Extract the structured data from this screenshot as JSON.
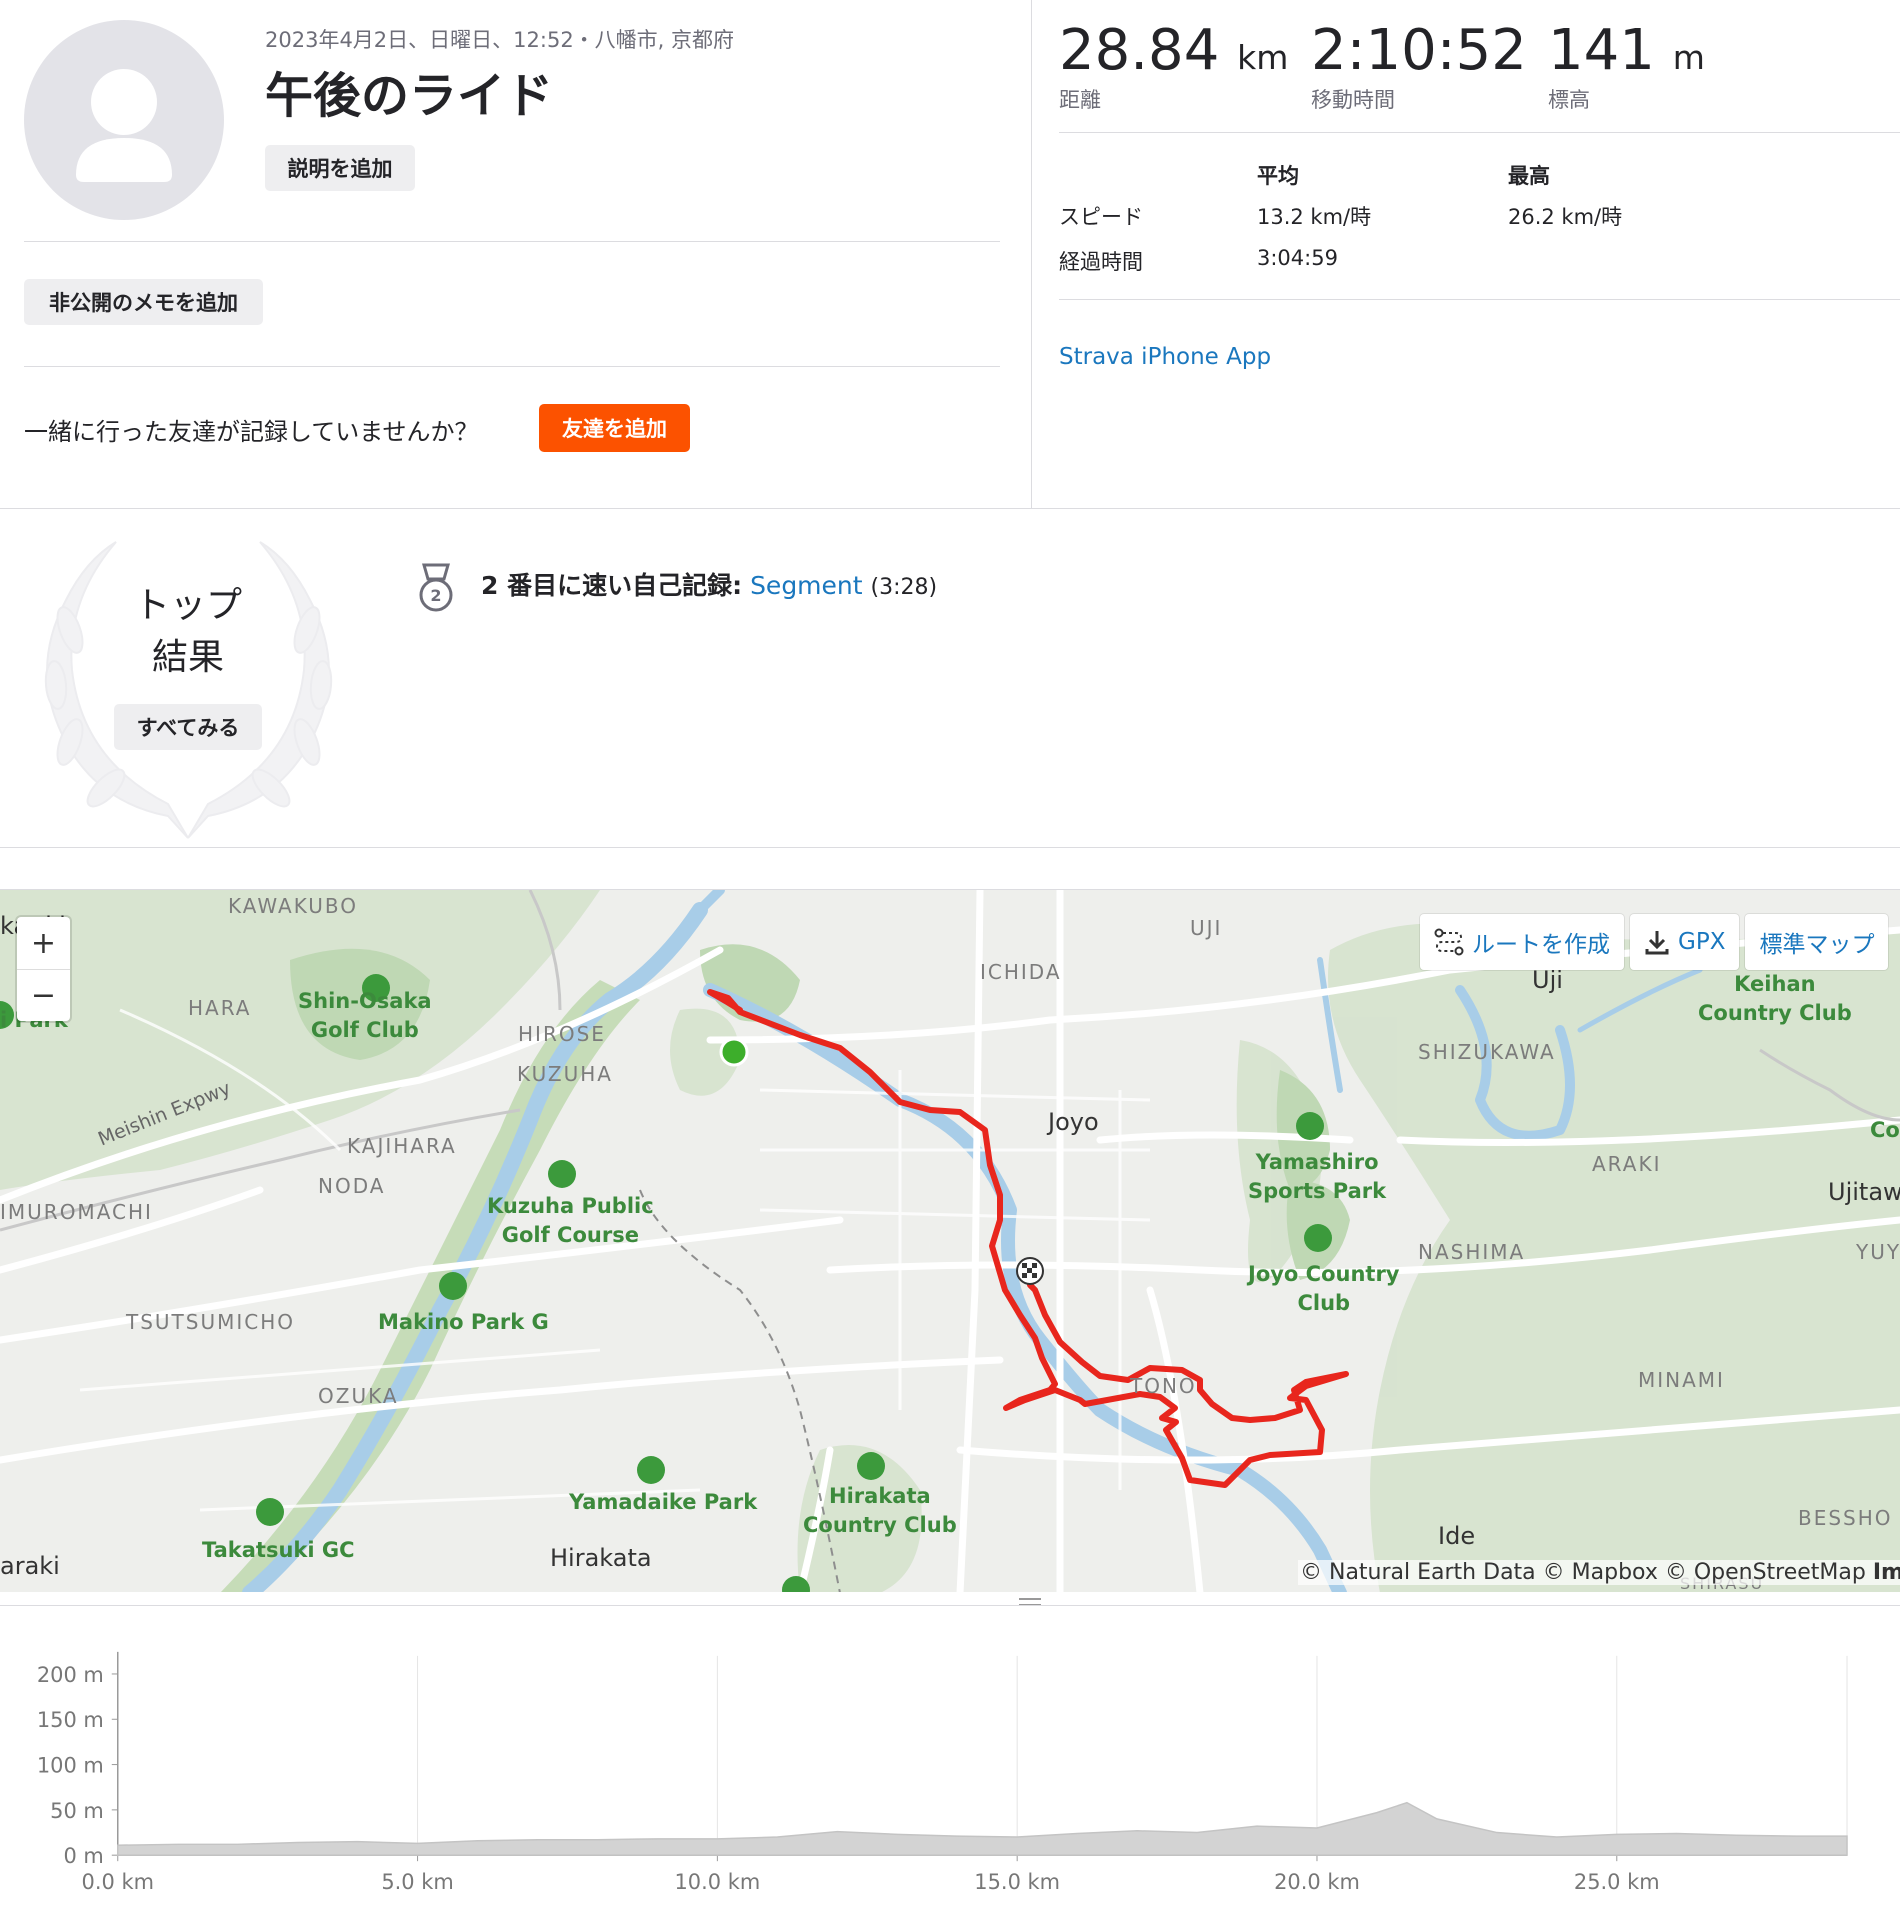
{
  "activity": {
    "meta_line": "2023年4月2日、日曜日、12:52・八幡市, 京都府",
    "title": "午後のライド",
    "add_description": "説明を追加",
    "add_private_note": "非公開のメモを追加",
    "friends_question": "一緒に行った友達が記録していませんか？",
    "add_friends": "友達を追加"
  },
  "stats": {
    "distance": {
      "value": "28.84",
      "unit": "km",
      "label": "距離"
    },
    "moving_time": {
      "value": "2:10:52",
      "label": "移動時間"
    },
    "elevation": {
      "value": "141",
      "unit": "m",
      "label": "標高"
    },
    "table": {
      "col_avg": "平均",
      "col_max": "最高",
      "speed_label": "スピード",
      "speed_avg": "13.2 km/時",
      "speed_max": "26.2 km/時",
      "elapsed_label": "経過時間",
      "elapsed_value": "3:04:59"
    },
    "device": "Strava iPhone App"
  },
  "achievements": {
    "top_results_label_line1": "トップ",
    "top_results_label_line2": "結果",
    "see_all": "すべてみる",
    "pr_text": "2 番目に速い自己記録:",
    "pr_segment": "Segment",
    "pr_time": "(3:28)",
    "medal_number": "2"
  },
  "map": {
    "zoom_in": "+",
    "zoom_out": "−",
    "controls": {
      "create_route": "ルートを作成",
      "gpx": "GPX",
      "map_style": "標準マップ"
    },
    "attribution": "© Natural Earth Data © Mapbox © OpenStreetMap",
    "attribution_more": "Imp",
    "labels": {
      "kawakubo": "KAWAKUBO",
      "hara": "HARA",
      "shin_osaka": [
        "Shin-Osaka",
        "Golf Club"
      ],
      "hirose": "HIROSE",
      "kuzuha": "KUZUHA",
      "kajihara": "KAJIHARA",
      "noda": "NODA",
      "kuzuha_golf": [
        "Kuzuha Public",
        "Golf Course"
      ],
      "makino": "Makino Park G",
      "imuromachi": "IMUROMACHI",
      "tsutsumicho": "TSUTSUMICHO",
      "ozuka": "OZUKA",
      "takatsuki_gc": "Takatsuki GC",
      "araki_left": "araki",
      "hirakata": "Hirakata",
      "yamadaike": "Yamadaike Park",
      "hirakata_cc": [
        "Hirakata",
        "Country Club"
      ],
      "ichida": "ICHIDA",
      "joyo": "Joyo",
      "uji_top": "UJI",
      "uji": "Uji",
      "shizukawa": "SHIZUKAWA",
      "keihan": [
        "Keihan",
        "Country Club"
      ],
      "yamashiro": [
        "Yamashiro",
        "Sports Park"
      ],
      "joyo_cc": [
        "Joyo Country",
        "Club"
      ],
      "araki_right": "ARAKI",
      "ujitawa": "Ujitawa",
      "nashima": "NASHIMA",
      "yuy": "YUY",
      "tono": "TONO",
      "minami": "MINAMI",
      "ide": "Ide",
      "bessho": "BESSHO",
      "shirasu": "SHIRASU",
      "meishin": "Meishin Expwy",
      "takatsuki": "kat ki",
      "left_park": "i Park",
      "co": "Co"
    }
  },
  "elevation_chart": {
    "y_ticks": [
      "200 m",
      "150 m",
      "100 m",
      "50 m",
      "0 m"
    ],
    "x_ticks": [
      "0.0 km",
      "5.0 km",
      "10.0 km",
      "15.0 km",
      "20.0 km",
      "25.0 km"
    ],
    "ylim": [
      0,
      220
    ],
    "xlim": [
      0,
      28.84
    ],
    "fill_color": "#d3d3d3",
    "profile": [
      [
        0,
        11
      ],
      [
        1,
        12
      ],
      [
        2,
        12
      ],
      [
        3,
        14
      ],
      [
        4,
        15
      ],
      [
        5,
        13
      ],
      [
        6,
        16
      ],
      [
        7,
        17
      ],
      [
        8,
        17
      ],
      [
        9,
        18
      ],
      [
        10,
        18
      ],
      [
        11,
        20
      ],
      [
        12,
        26
      ],
      [
        13,
        23
      ],
      [
        14,
        21
      ],
      [
        15,
        20
      ],
      [
        16,
        24
      ],
      [
        17,
        27
      ],
      [
        18,
        25
      ],
      [
        19,
        32
      ],
      [
        20,
        30
      ],
      [
        21,
        47
      ],
      [
        21.5,
        58
      ],
      [
        22,
        40
      ],
      [
        23,
        25
      ],
      [
        24,
        20
      ],
      [
        25,
        23
      ],
      [
        26,
        24
      ],
      [
        27,
        22
      ],
      [
        28,
        21
      ],
      [
        28.84,
        21
      ]
    ]
  },
  "colors": {
    "accent": "#fc5200",
    "link": "#1a77be",
    "route": "#e8261d",
    "start": "#3dae2b"
  }
}
